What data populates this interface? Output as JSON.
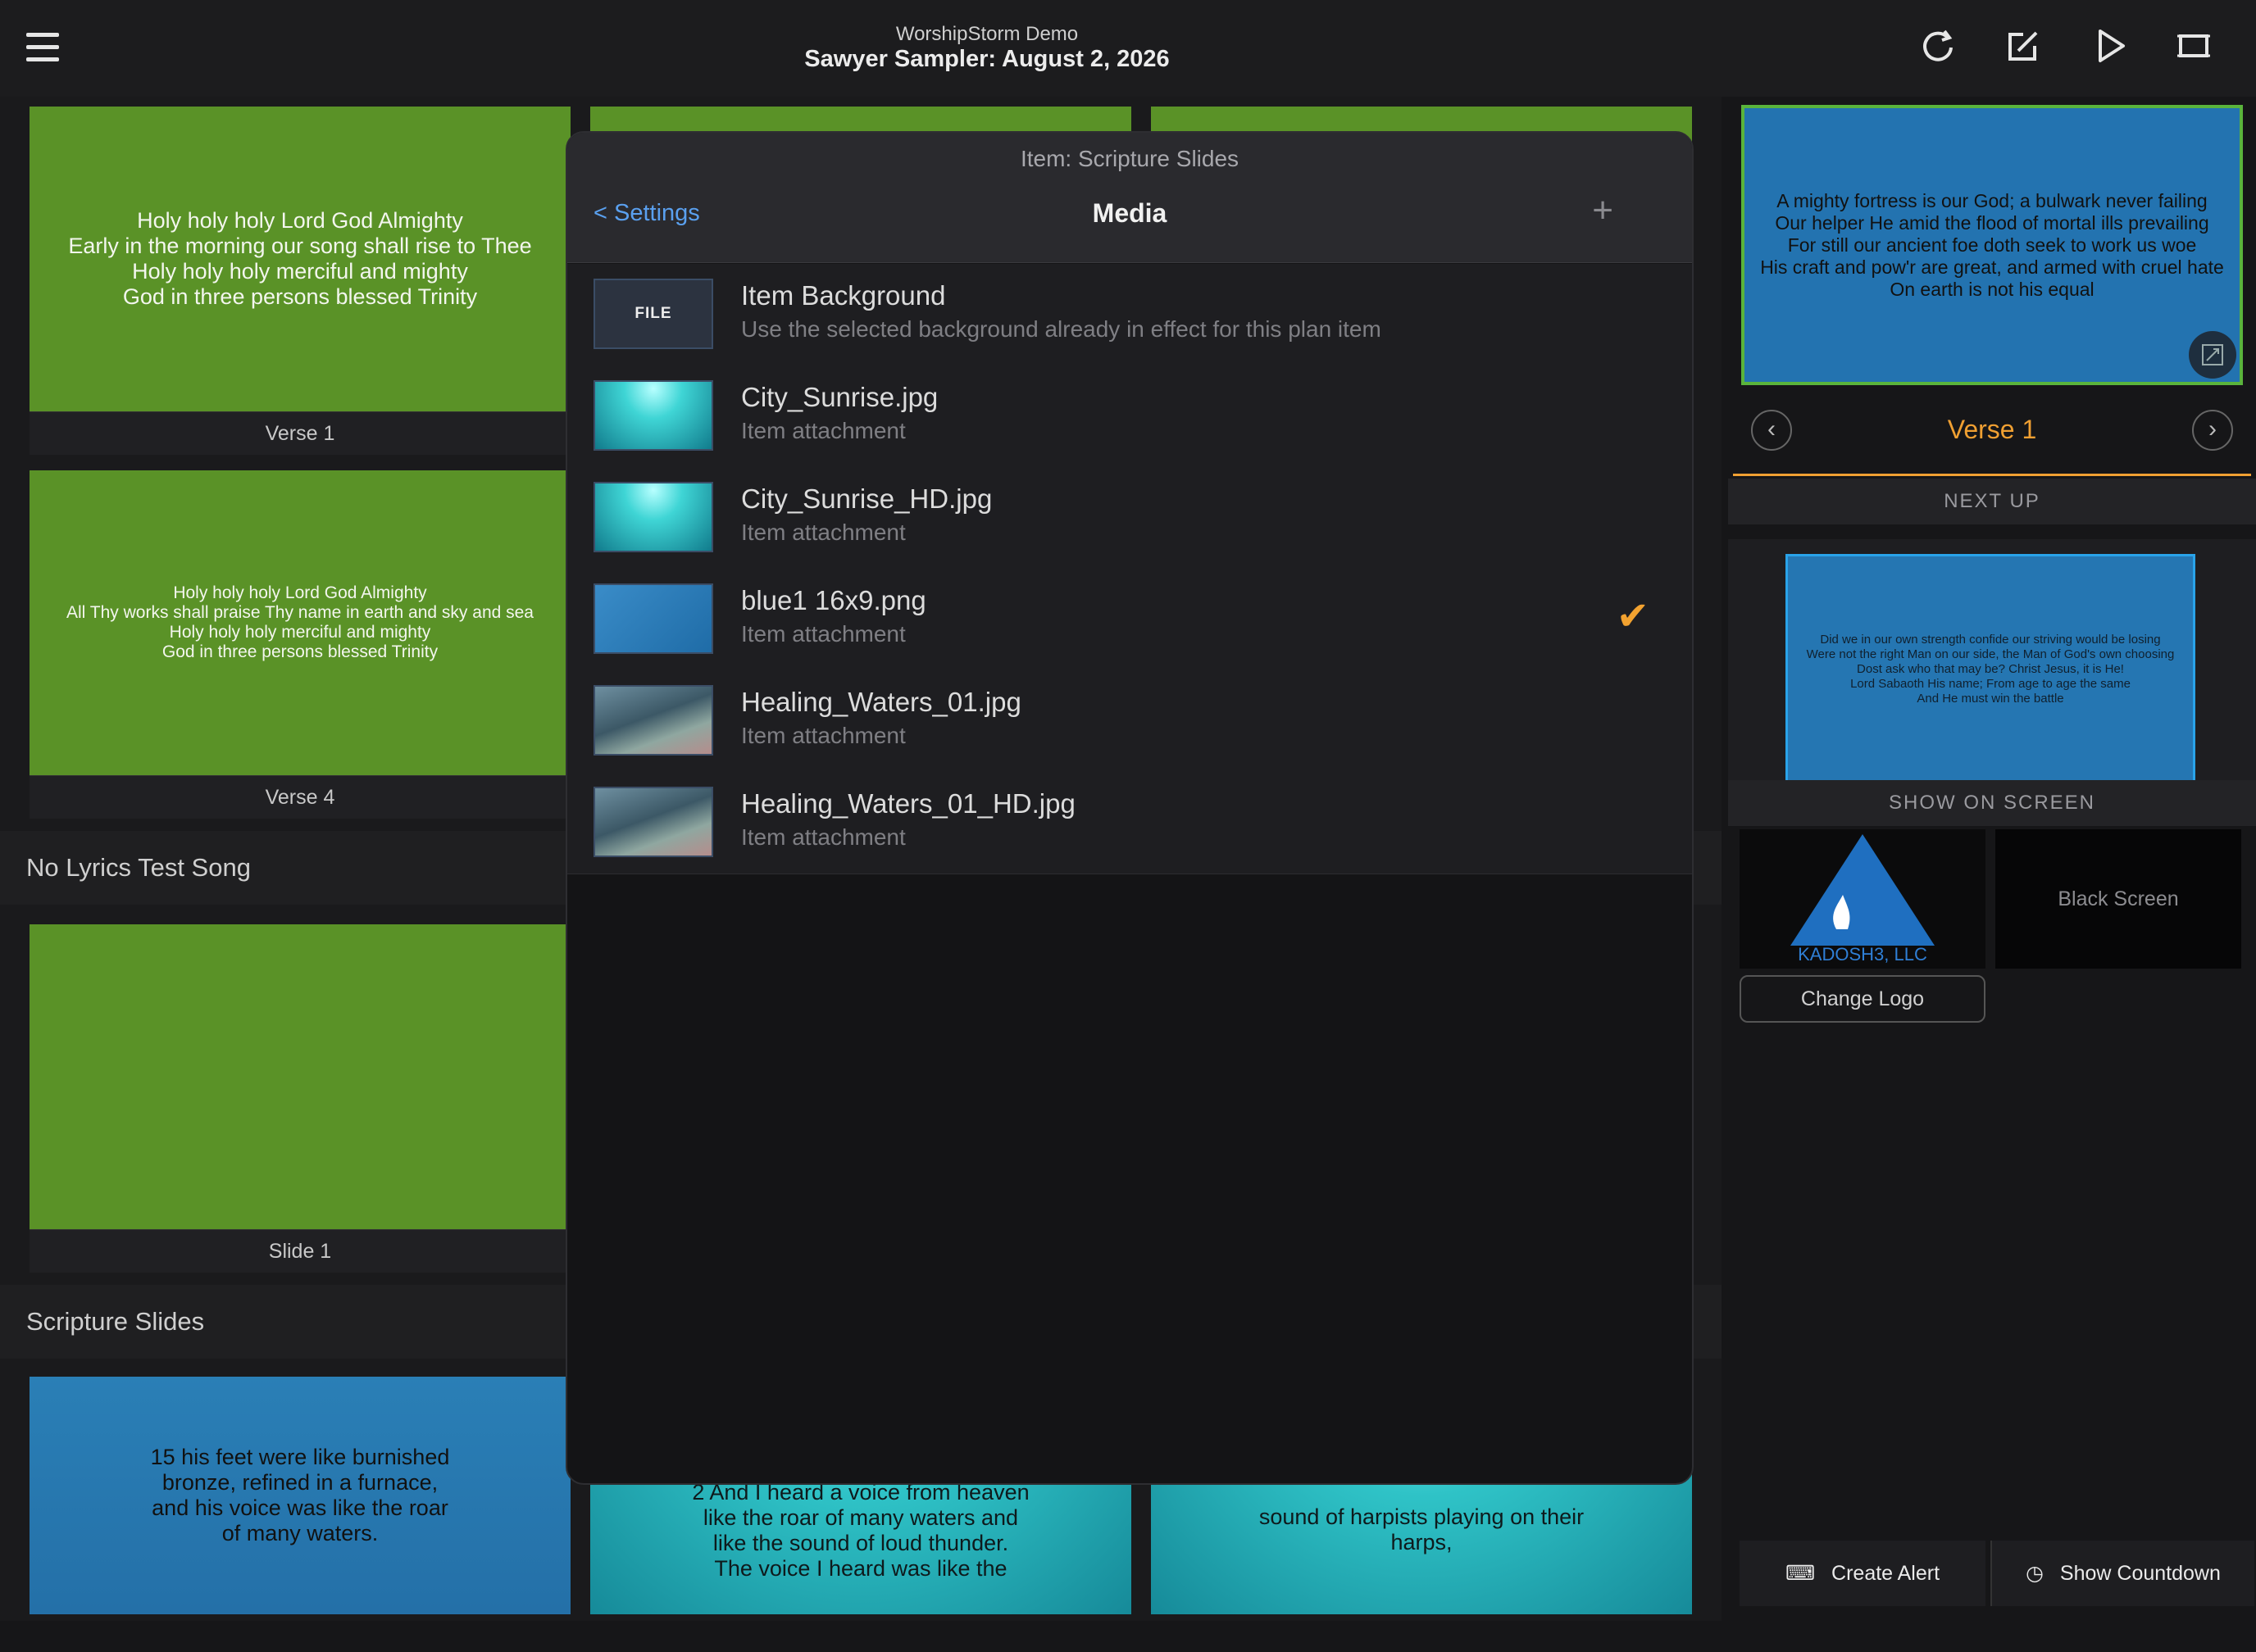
{
  "header": {
    "subtitle": "WorshipStorm Demo",
    "title": "Sawyer Sampler: August 2, 2026"
  },
  "slides": {
    "s1_lines": [
      "Holy holy holy Lord God Almighty",
      "Early in the morning our song shall rise to Thee",
      "Holy holy holy merciful and mighty",
      "God in three persons blessed Trinity"
    ],
    "s1_label": "Verse 1",
    "s2_lines": [
      "Holy holy holy Lord God Almighty",
      "All Thy works shall praise Thy name in earth and sky and sea",
      "Holy holy holy merciful and mighty",
      "God in three persons blessed Trinity"
    ],
    "s2_label": "Verse 4",
    "section2": "No Lyrics Test Song",
    "s3_label": "Slide 1",
    "section3": "Scripture Slides",
    "sc1": [
      "15 his feet were like burnished",
      "bronze, refined in a furnace,",
      "and his voice was like the roar",
      "of many waters."
    ],
    "sc2": [
      "2 And I heard a voice from heaven",
      "like the roar of many waters and",
      "like the sound of loud thunder.",
      "The voice I heard was like the"
    ],
    "sc3": [
      "sound of harpists playing on their",
      "harps,"
    ]
  },
  "modal": {
    "subtitle": "Item: Scripture Slides",
    "back": "< Settings",
    "title": "Media",
    "add": "+",
    "file_label": "FILE",
    "items": [
      {
        "name": "Item Background",
        "desc": "Use the selected background already in effect for this plan item",
        "thumb": "file"
      },
      {
        "name": "City_Sunrise.jpg",
        "desc": "Item attachment",
        "thumb": "city"
      },
      {
        "name": "City_Sunrise_HD.jpg",
        "desc": "Item attachment",
        "thumb": "city"
      },
      {
        "name": "blue1 16x9.png",
        "desc": "Item attachment",
        "thumb": "blue",
        "selected": true
      },
      {
        "name": "Healing_Waters_01.jpg",
        "desc": "Item attachment",
        "thumb": "water"
      },
      {
        "name": "Healing_Waters_01_HD.jpg",
        "desc": "Item attachment",
        "thumb": "water"
      }
    ]
  },
  "right": {
    "live_lines": [
      "A mighty fortress is our God; a bulwark never failing",
      "Our helper He amid the flood of mortal ills prevailing",
      "For still our ancient foe doth seek to work us woe",
      "His craft and pow'r are great, and armed with cruel hate",
      "On earth is not his equal"
    ],
    "verse": "Verse 1",
    "next_up": "NEXT UP",
    "next_lines": [
      "Did we in our own strength confide our striving would be losing",
      "Were not the right Man on our side, the Man of God's own choosing",
      "Dost ask who that may be? Christ Jesus, it is He!",
      "Lord Sabaoth His name; From age to age the same",
      "And He must win the battle"
    ],
    "show_on_screen": "SHOW ON SCREEN",
    "logo_text": "KADOSH3, LLC",
    "black_screen": "Black Screen",
    "change_logo": "Change Logo",
    "create_alert": "Create Alert",
    "show_countdown": "Show Countdown"
  },
  "colors": {
    "accent": "#f0a032",
    "link": "#5aa0ef",
    "slide_green": "#5a9227",
    "slide_blue": "#2373b0"
  }
}
